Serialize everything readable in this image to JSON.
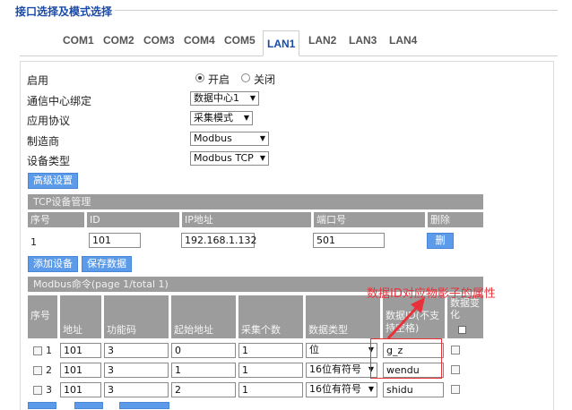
{
  "section": {
    "legend": "接口选择及模式选择"
  },
  "tabs": [
    "COM1",
    "COM2",
    "COM3",
    "COM4",
    "COM5",
    "LAN1",
    "LAN2",
    "LAN3",
    "LAN4"
  ],
  "active_tab": "LAN1",
  "form": {
    "enable_label": "启用",
    "enable_on": "开启",
    "enable_off": "关闭",
    "center_label": "通信中心绑定",
    "center_value": "数据中心1",
    "protocol_label": "应用协议",
    "protocol_value": "采集模式",
    "vendor_label": "制造商",
    "vendor_value": "Modbus",
    "device_label": "设备类型",
    "device_value": "Modbus TCP",
    "advanced_button": "高级设置"
  },
  "tcp": {
    "title": "TCP设备管理",
    "headers": [
      "序号",
      "ID",
      "IP地址",
      "端口号",
      "删除"
    ],
    "row": {
      "index": "1",
      "id": "101",
      "ip": "192.168.1.132",
      "port": "501",
      "delete": "删除"
    },
    "add_button": "添加设备",
    "save_button": "保存数据"
  },
  "modbus": {
    "title": "Modbus命令(page 1/total 1)",
    "headers": {
      "index": "序号",
      "addr": "地址",
      "func": "功能码",
      "start": "起始地址",
      "count": "采集个数",
      "dtype": "数据类型",
      "dataid": "数据ID(不支持空格)",
      "change": "数据变化"
    },
    "rows": [
      {
        "index": "1",
        "addr": "101",
        "func": "3",
        "start": "0",
        "count": "1",
        "dtype": "位",
        "dataid": "g_z"
      },
      {
        "index": "2",
        "addr": "101",
        "func": "3",
        "start": "1",
        "count": "1",
        "dtype": "16位有符号",
        "dataid": "wendu"
      },
      {
        "index": "3",
        "addr": "101",
        "func": "3",
        "start": "2",
        "count": "1",
        "dtype": "16位有符号",
        "dataid": "shidu"
      }
    ]
  },
  "annotation": {
    "text": "数据ID对应物影子的属性",
    "color": "#e8313a"
  },
  "colors": {
    "accent": "#1a4aa8",
    "button": "#5c9bea",
    "header_gray": "#9c9c9c"
  }
}
